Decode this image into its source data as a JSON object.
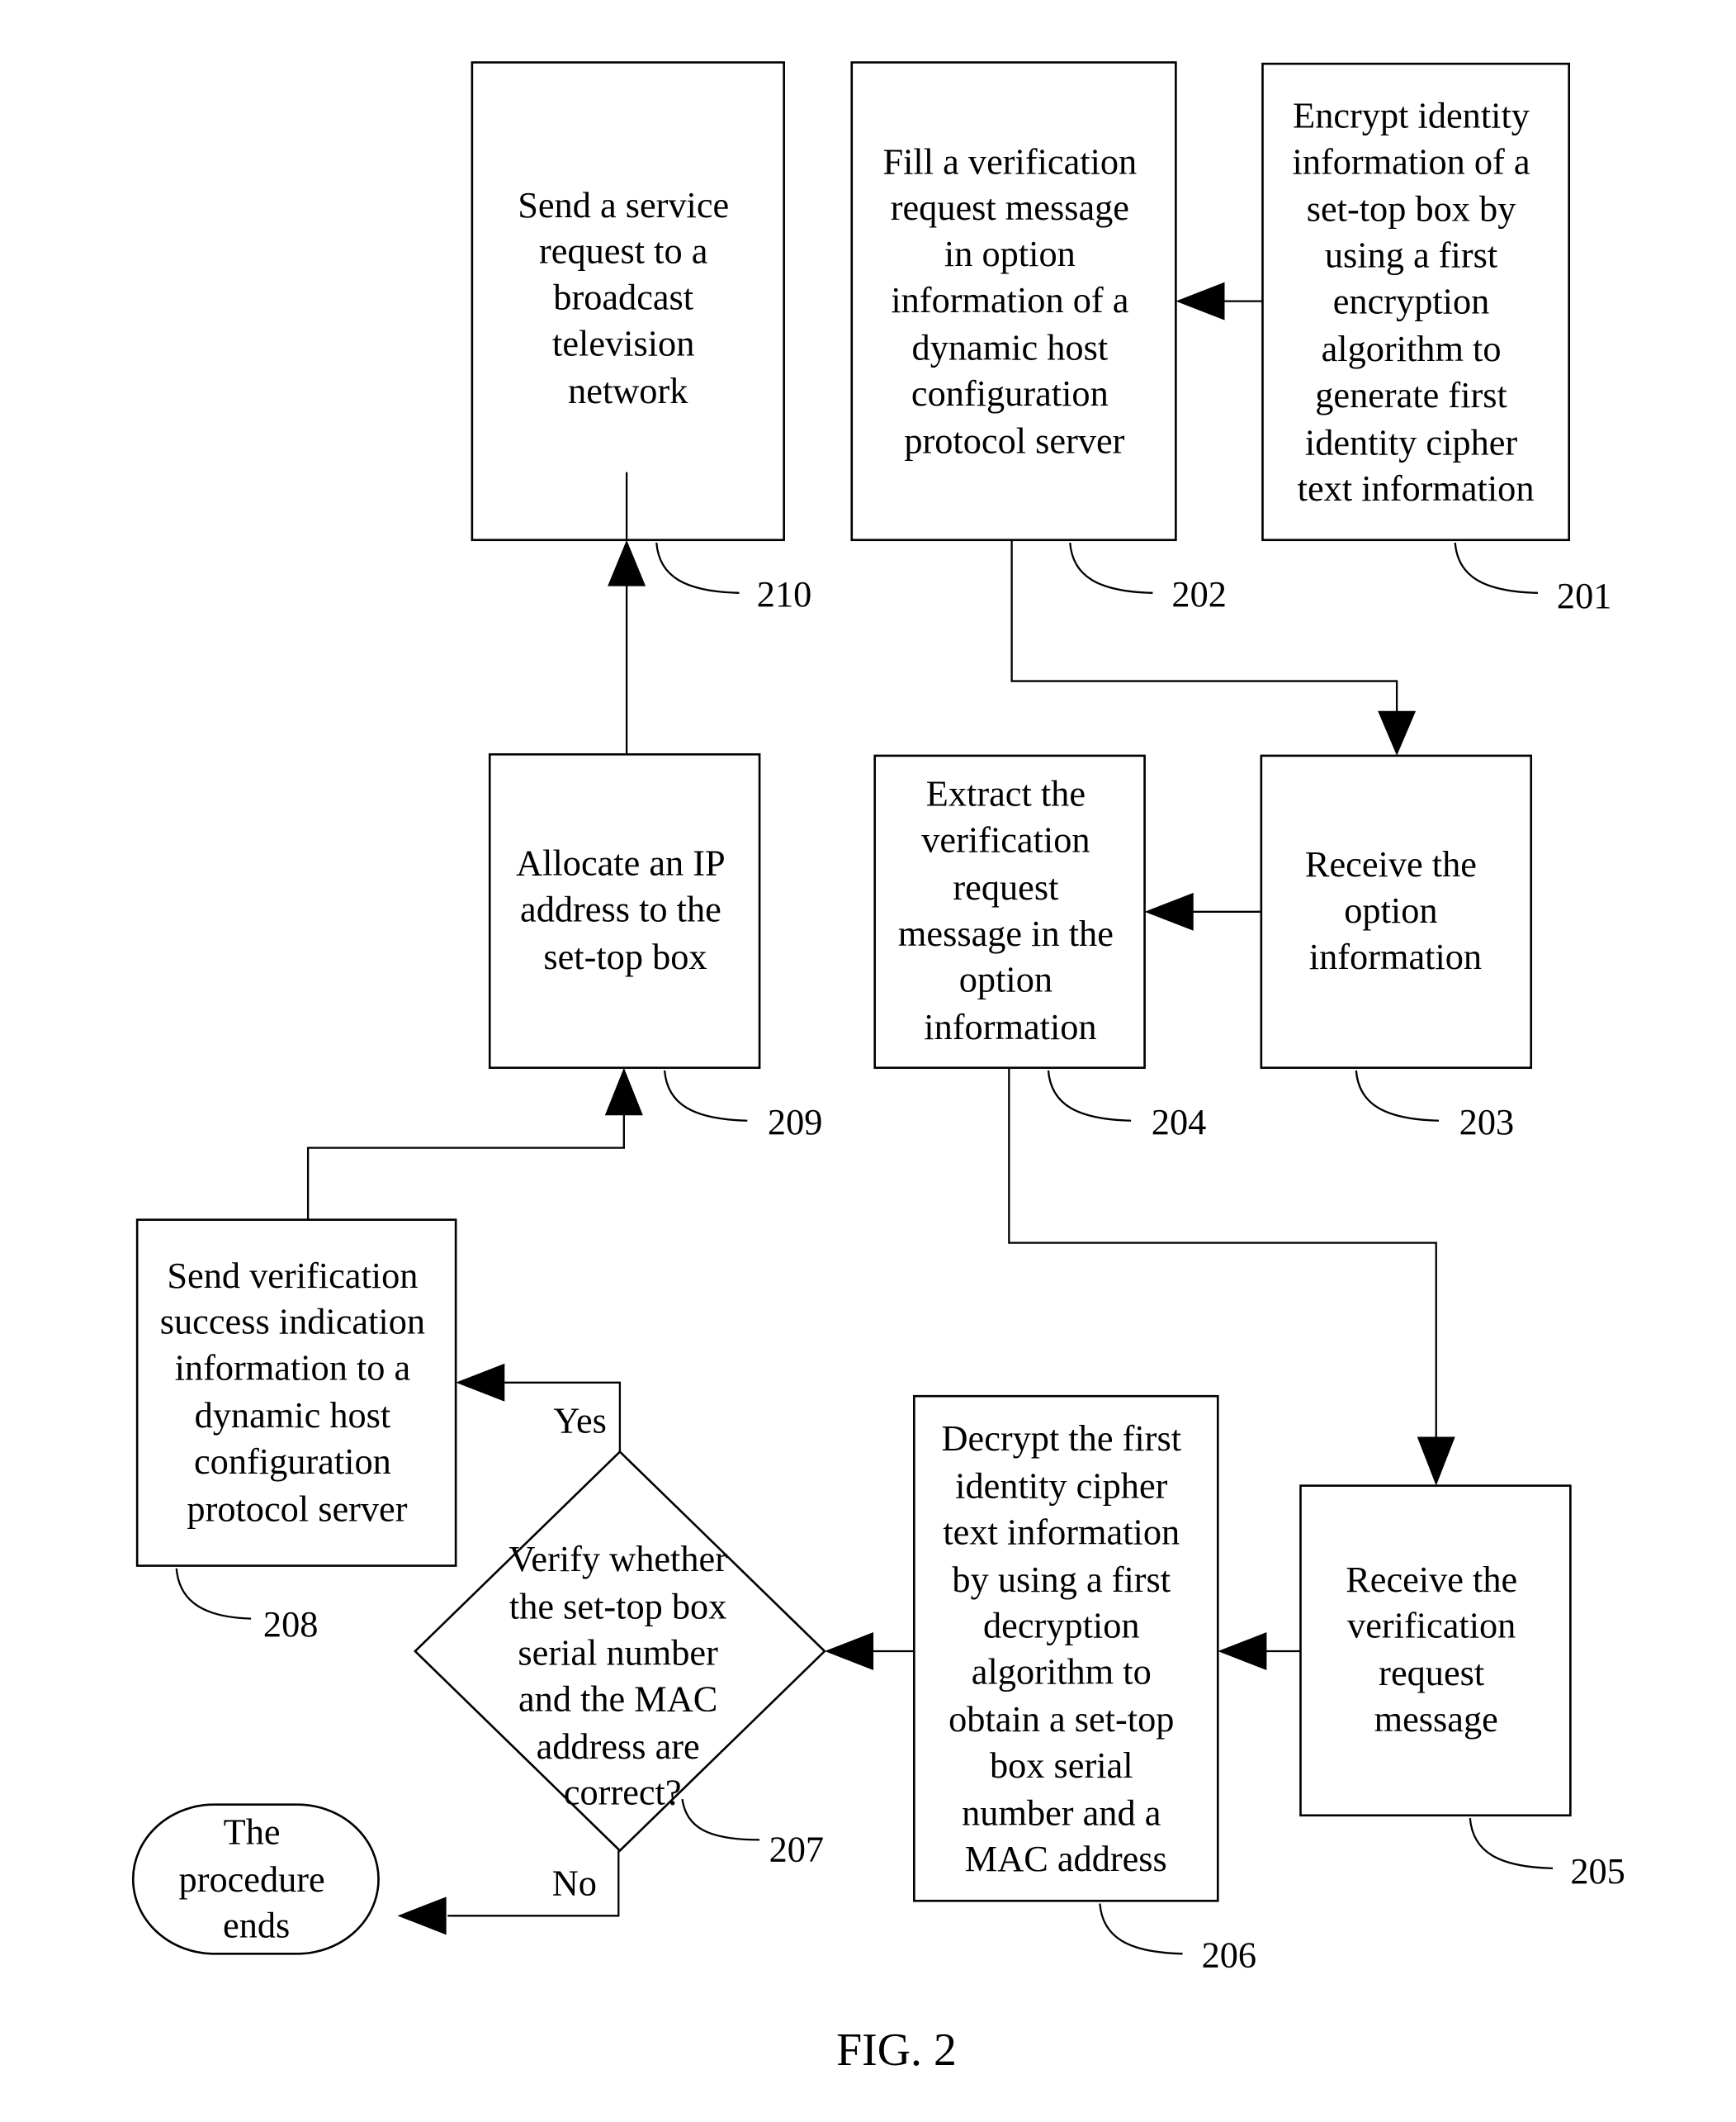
{
  "figure": {
    "caption": "FIG. 2"
  },
  "steps": {
    "s201": {
      "ref": "201",
      "lines": [
        "Encrypt identity",
        "information of a",
        "set-top box by",
        "using a first",
        "encryption",
        "algorithm to",
        "generate first",
        "identity cipher",
        "text information"
      ]
    },
    "s202": {
      "ref": "202",
      "lines": [
        "Fill a verification",
        "request message",
        "in option",
        "information of a",
        "dynamic host",
        "configuration",
        "protocol server"
      ]
    },
    "s203": {
      "ref": "203",
      "lines": [
        "Receive the",
        "option",
        "information"
      ]
    },
    "s204": {
      "ref": "204",
      "lines": [
        "Extract the",
        "verification",
        "request",
        "message in the",
        "option",
        "information"
      ]
    },
    "s205": {
      "ref": "205",
      "lines": [
        "Receive the",
        "verification",
        "request",
        "message"
      ]
    },
    "s206": {
      "ref": "206",
      "lines": [
        "Decrypt the first",
        "identity cipher",
        "text information",
        "by using a first",
        "decryption",
        "algorithm to",
        "obtain a set-top",
        "box serial",
        "number and a",
        "MAC address"
      ]
    },
    "s207": {
      "ref": "207",
      "lines": [
        "Verify whether",
        "the set-top box",
        "serial number",
        "and the MAC",
        "address are",
        "correct?"
      ]
    },
    "s208": {
      "ref": "208",
      "lines": [
        "Send verification",
        "success indication",
        "information to a",
        "dynamic host",
        "configuration",
        "protocol server"
      ]
    },
    "s209": {
      "ref": "209",
      "lines": [
        "Allocate an IP",
        "address to the",
        "set-top box"
      ]
    },
    "s210": {
      "ref": "210",
      "lines": [
        "Send a service",
        "request to a",
        "broadcast",
        "television",
        "network"
      ]
    },
    "end": {
      "lines": [
        "The",
        "procedure",
        "ends"
      ]
    }
  },
  "branches": {
    "yes": "Yes",
    "no": "No"
  }
}
